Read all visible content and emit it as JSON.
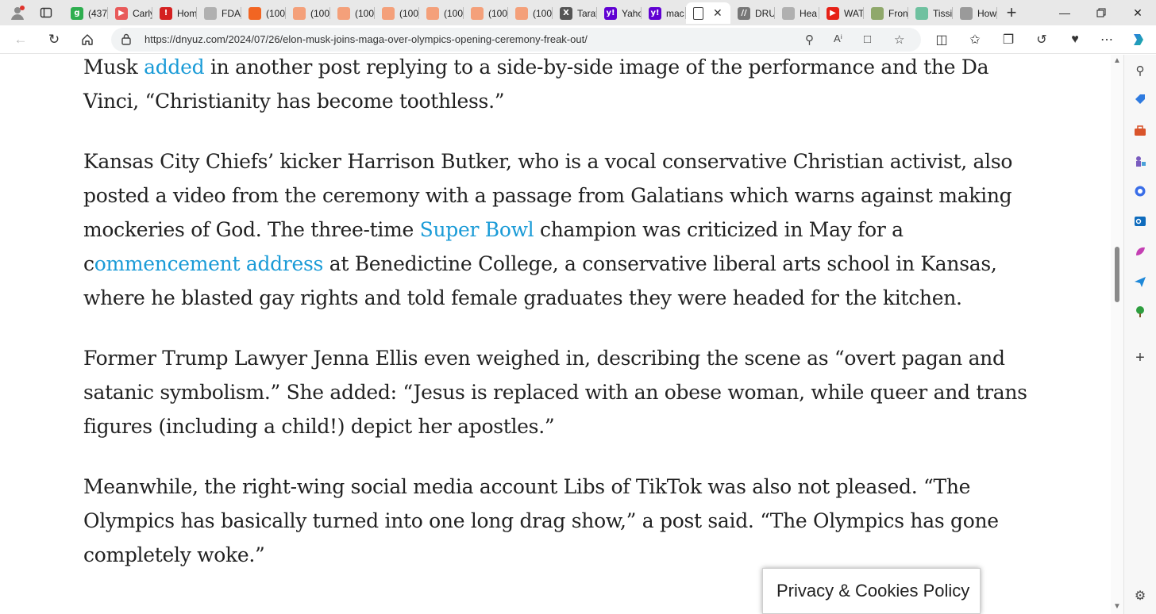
{
  "tabs": [
    {
      "label": "(437",
      "fav_text": "g",
      "fav_color": "#2eae4f"
    },
    {
      "label": "Carly",
      "fav_text": "▶",
      "fav_color": "#e85a5a"
    },
    {
      "label": "Hom",
      "fav_text": "!",
      "fav_color": "#d42020"
    },
    {
      "label": "FDA",
      "fav_text": "",
      "fav_color": "#b0b0b0"
    },
    {
      "label": "(100",
      "fav_text": "",
      "fav_color": "#f26522"
    },
    {
      "label": "(100",
      "fav_text": "",
      "fav_color": "#f4a07a"
    },
    {
      "label": "(100",
      "fav_text": "",
      "fav_color": "#f4a07a"
    },
    {
      "label": "(100",
      "fav_text": "",
      "fav_color": "#f4a07a"
    },
    {
      "label": "(100",
      "fav_text": "",
      "fav_color": "#f4a07a"
    },
    {
      "label": "(100",
      "fav_text": "",
      "fav_color": "#f4a07a"
    },
    {
      "label": "(100",
      "fav_text": "",
      "fav_color": "#f4a07a"
    },
    {
      "label": "Tarat",
      "fav_text": "X",
      "fav_color": "#555555"
    },
    {
      "label": "Yaho",
      "fav_text": "y!",
      "fav_color": "#6001d2"
    },
    {
      "label": "mac",
      "fav_text": "y!",
      "fav_color": "#6001d2"
    },
    {
      "label": "",
      "fav_text": "",
      "fav_color": "#ffffff",
      "active": true
    },
    {
      "label": "DRU",
      "fav_text": "//",
      "fav_color": "#777777"
    },
    {
      "label": "Hea",
      "fav_text": "",
      "fav_color": "#b0b0b0"
    },
    {
      "label": "WAT",
      "fav_text": "▶",
      "fav_color": "#e62117"
    },
    {
      "label": "Fron",
      "fav_text": "",
      "fav_color": "#8fa86b"
    },
    {
      "label": "Tissi",
      "fav_text": "",
      "fav_color": "#6fc1a0"
    },
    {
      "label": "How",
      "fav_text": "",
      "fav_color": "#9a9a9a"
    }
  ],
  "address_bar": {
    "url": "https://dnyuz.com/2024/07/26/elon-musk-joins-maga-over-olympics-opening-ceremony-freak-out/"
  },
  "article": {
    "p1": {
      "t1": "Musk ",
      "link1": "added",
      "t2": " in another post replying to a side-by-side image of the performance and the Da Vinci, “Christianity has become toothless.”"
    },
    "p2": {
      "t1": "Kansas City Chiefs’ kicker Harrison Butker, who is a vocal conservative Christian activist, also posted a video from the ceremony with a passage from Galatians which warns against making mockeries of God. The three-time ",
      "link1": "Super Bowl",
      "t2": " champion was criticized in May for a c",
      "link2": "ommencement address",
      "t3": " at Benedictine College, a conservative liberal arts school in Kansas, where he blasted gay rights and told female graduates they were headed for the kitchen."
    },
    "p3": "Former Trump Lawyer Jenna Ellis even weighed in, describing the scene as “overt pagan and satanic symbolism.” She added: “Jesus is replaced with an obese woman, while queer and trans figures (including a child!) depict her apostles.”",
    "p4": "Meanwhile, the right-wing social media account Libs of TikTok was also not pleased. “The Olympics has basically turned into one long drag show,” a post said. “The Olympics has gone completely woke.”"
  },
  "privacy_button": "Privacy & Cookies Policy",
  "colors": {
    "link": "#1a9bd7",
    "text": "#222222",
    "tabbar": "#e8e8e8"
  }
}
